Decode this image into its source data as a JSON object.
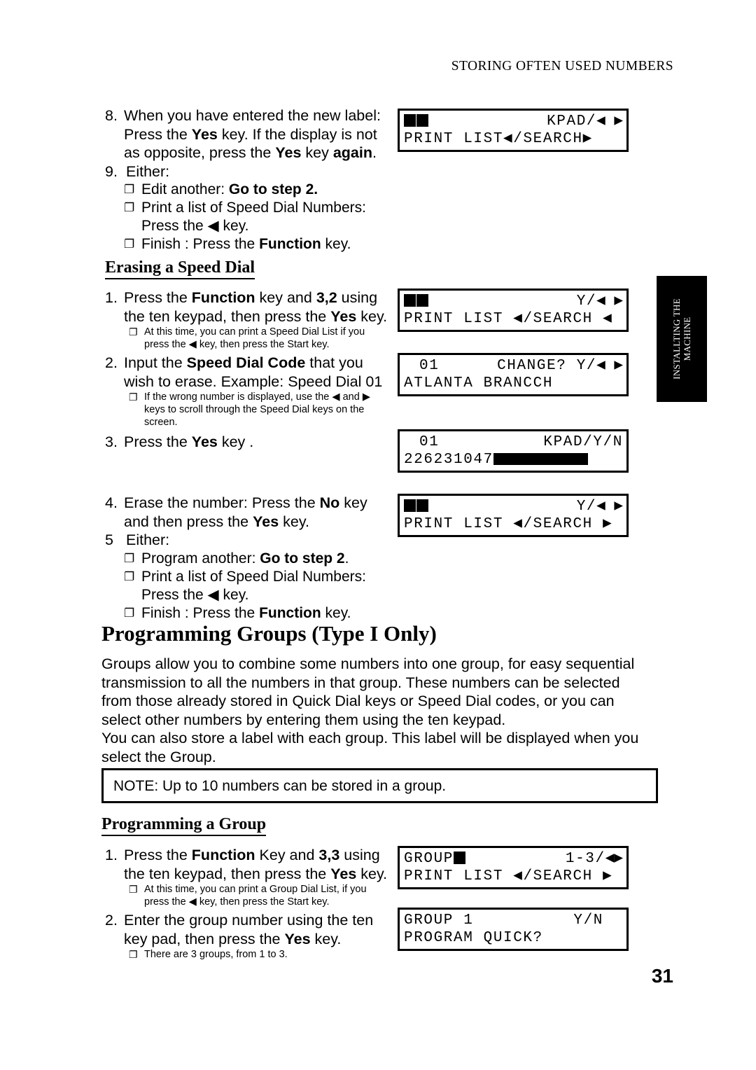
{
  "running_head": "STORING OFTEN USED NUMBERS",
  "page_number": "31",
  "side_tab": {
    "line1": "INSTALLTING THE",
    "line2": "MACHINE"
  },
  "bullet_glyph": "❐",
  "arrow_left": "◀",
  "arrow_right": "▶",
  "top_section": {
    "step8": {
      "num": "8.",
      "line1_a": "When you have entered the new label:",
      "line2_a": "Press the ",
      "line2_b": "Yes",
      "line2_c": " key. If the display is not",
      "line3_a": "as opposite, press the ",
      "line3_b": "Yes",
      "line3_c": " key ",
      "line3_d": "again",
      "line3_e": "."
    },
    "step9": {
      "num": "9.",
      "label": "Either:",
      "bullets": [
        {
          "text_a": "Edit another: ",
          "bold": "Go to step 2.",
          "text_b": ""
        },
        {
          "text_a": "Print a list of Speed Dial Numbers: Press the ",
          "bold": "",
          "text_b": " key."
        },
        {
          "text_a": "Finish : Press the ",
          "bold": "Function",
          "text_b": " key."
        }
      ]
    }
  },
  "erasing": {
    "heading": "Erasing a Speed Dial",
    "step1": {
      "num": "1.",
      "line1_a": "Press the ",
      "line1_b": "Function",
      "line1_c": " key and ",
      "line1_d": "3,2",
      "line1_e": " using",
      "line2_a": "the ten keypad, then press the ",
      "line2_b": "Yes",
      "line2_c": " key.",
      "note_a": "At this time, you can print a Speed Dial List if you",
      "note_b": "press the ",
      "note_c": " key, then press the Start key."
    },
    "step2": {
      "num": "2.",
      "line1_a": "Input the ",
      "line1_b": "Speed Dial Code",
      "line1_c": " that you",
      "line2": "wish to erase. Example: Speed Dial 01",
      "note_a": "If the wrong number is displayed, use the ",
      "note_b": " and ",
      "note_c": "",
      "note_line2": "keys to scroll through the Speed Dial keys on the",
      "note_line3": "screen."
    },
    "step3": {
      "num": "3.",
      "line1_a": "Press the ",
      "line1_b": "Yes",
      "line1_c": " key ."
    },
    "step4": {
      "num": "4.",
      "line1_a": "Erase the number: Press the ",
      "line1_b": "No",
      "line1_c": " key",
      "line2_a": "and then press the ",
      "line2_b": "Yes",
      "line2_c": " key."
    },
    "step5": {
      "num": "5",
      "label": "Either:",
      "bullets": [
        {
          "text_a": "Program another: ",
          "bold": "Go to step 2",
          "text_b": "."
        },
        {
          "text_a": "Print a list of Speed Dial Numbers: Press the ",
          "bold": "",
          "text_b": " key."
        },
        {
          "text_a": "Finish : Press the ",
          "bold": "Function",
          "text_b": " key."
        }
      ]
    }
  },
  "groups": {
    "heading": "Programming Groups (Type I Only)",
    "para1_line1": "Groups allow you to combine some numbers into one group, for easy sequential",
    "para1_line2": "transmission to all the numbers in that group. These numbers can be selected",
    "para1_line3": "from those already stored in Quick Dial keys or Speed Dial codes, or you can",
    "para1_line4": "select other numbers by entering them using the ten keypad.",
    "para2_line1": "You can also store a label with each group. This label will be displayed when you",
    "para2_line2": "select the Group.",
    "note_box": "NOTE: Up to 10 numbers can be stored in a group.",
    "sub_heading": "Programming a Group",
    "step1": {
      "num": "1.",
      "line1_a": "Press the ",
      "line1_b": "Function",
      "line1_c": " Key and ",
      "line1_d": "3,3",
      "line1_e": " using",
      "line2_a": "the ten keypad, then press the ",
      "line2_b": "Yes",
      "line2_c": " key.",
      "note_a": "At this time, you can print a Group Dial List, if you",
      "note_b": "press the ",
      "note_c": " key, then press the Start key."
    },
    "step2": {
      "num": "2.",
      "line1": "Enter the group number using the ten",
      "line2_a": "key pad, then press the ",
      "line2_b": "Yes",
      "line2_c": "  key.",
      "note": "There are 3 groups, from 1 to 3."
    }
  },
  "lcds": {
    "lcd1": {
      "line1_left_blocks": 2,
      "line1_right": "KPAD/",
      "line1_arrows": "◀ ▶",
      "line2_left": "PRINT LIST◀/SEARCH▶"
    },
    "lcd2": {
      "line1_left_blocks": 2,
      "line1_right": "Y/",
      "line1_arrows": "◀ ▶",
      "line2_left": "PRINT LIST ◀/SEARCH ◀"
    },
    "lcd3": {
      "line1_left": "01",
      "line1_right": "CHANGE? Y/",
      "line1_arrows": "◀ ▶",
      "line2_left": "ATLANTA BRANCCH"
    },
    "lcd4": {
      "line1_left": "01",
      "line1_right": "KPAD/Y/N",
      "line2_left": "226231047",
      "line2_blocks": 9
    },
    "lcd5": {
      "line1_left_blocks": 2,
      "line1_right": "Y/",
      "line1_arrows": "◀ ▶",
      "line2_left": "PRINT LIST ◀/SEARCH ▶"
    },
    "lcd6": {
      "line1_left": "GROUP",
      "line1_left_blocks": 1,
      "line1_right": "1-3/",
      "line1_arrows": "◀▶",
      "line2_left": "PRINT LIST ◀/SEARCH ▶"
    },
    "lcd7": {
      "line1_left": "GROUP 1",
      "line1_right": "Y/N",
      "line2_left": "PROGRAM QUICK?"
    }
  }
}
